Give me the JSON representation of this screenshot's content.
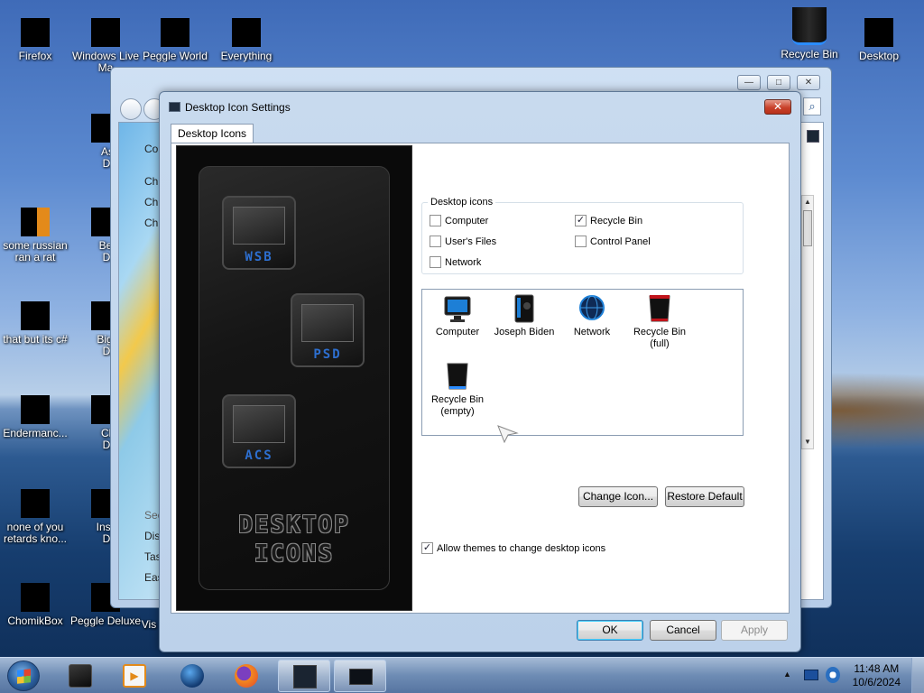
{
  "desktop": {
    "icons": [
      {
        "label": "Firefox"
      },
      {
        "label": "Windows Live Ma"
      },
      {
        "label": "Peggle World"
      },
      {
        "label": "Everything"
      },
      {
        "label": "Recycle Bin"
      },
      {
        "label": "Desktop"
      },
      {
        "label": "Astro Delu"
      },
      {
        "label": "some russian ran a rat"
      },
      {
        "label": "Bejew Delu"
      },
      {
        "label": "that but its c#"
      },
      {
        "label": "Big Mo Delu"
      },
      {
        "label": "Endermanc..."
      },
      {
        "label": "Chuz Delu"
      },
      {
        "label": "none of you retards kno..."
      },
      {
        "label": "Insaniq Delu"
      },
      {
        "label": "ChomikBox"
      },
      {
        "label": "Peggle Deluxe"
      },
      {
        "label": "Vis"
      }
    ]
  },
  "background_window": {
    "left_items": [
      "Co",
      "Ch",
      "Ch",
      "Ch"
    ],
    "bottom_items": [
      "See",
      "Dis",
      "Tas",
      "Eas"
    ]
  },
  "dialog": {
    "title": "Desktop Icon Settings",
    "close_label": "✕",
    "tab_label": "Desktop Icons",
    "art": {
      "tile1": "WSB",
      "tile2": "PSD",
      "tile3": "ACS",
      "title_line1": "DESKTOP",
      "title_line2": "ICONS"
    },
    "group_legend": "Desktop icons",
    "checkboxes": [
      {
        "label": "Computer",
        "checked": false
      },
      {
        "label": "Recycle Bin",
        "checked": true
      },
      {
        "label": "User's Files",
        "checked": false
      },
      {
        "label": "Control Panel",
        "checked": false
      },
      {
        "label": "Network",
        "checked": false
      }
    ],
    "icon_list": [
      {
        "label": "Computer",
        "icon": "monitor-icon"
      },
      {
        "label": "Joseph Biden",
        "icon": "user-files-icon"
      },
      {
        "label": "Network",
        "icon": "network-globe-icon"
      },
      {
        "label": "Recycle Bin (full)",
        "icon": "recycle-bin-full-icon"
      },
      {
        "label": "Recycle Bin (empty)",
        "icon": "recycle-bin-empty-icon"
      }
    ],
    "change_icon_label": "Change Icon...",
    "restore_default_label": "Restore Default",
    "allow_themes_label": "Allow themes to change desktop icons",
    "allow_themes_checked": true,
    "ok_label": "OK",
    "cancel_label": "Cancel",
    "apply_label": "Apply"
  },
  "taskbar": {
    "time": "11:48 AM",
    "date": "10/6/2024",
    "tray_arrow": "▲"
  },
  "colors": {
    "accent_blue": "#2d6fd0",
    "close_red": "#c8412a"
  }
}
